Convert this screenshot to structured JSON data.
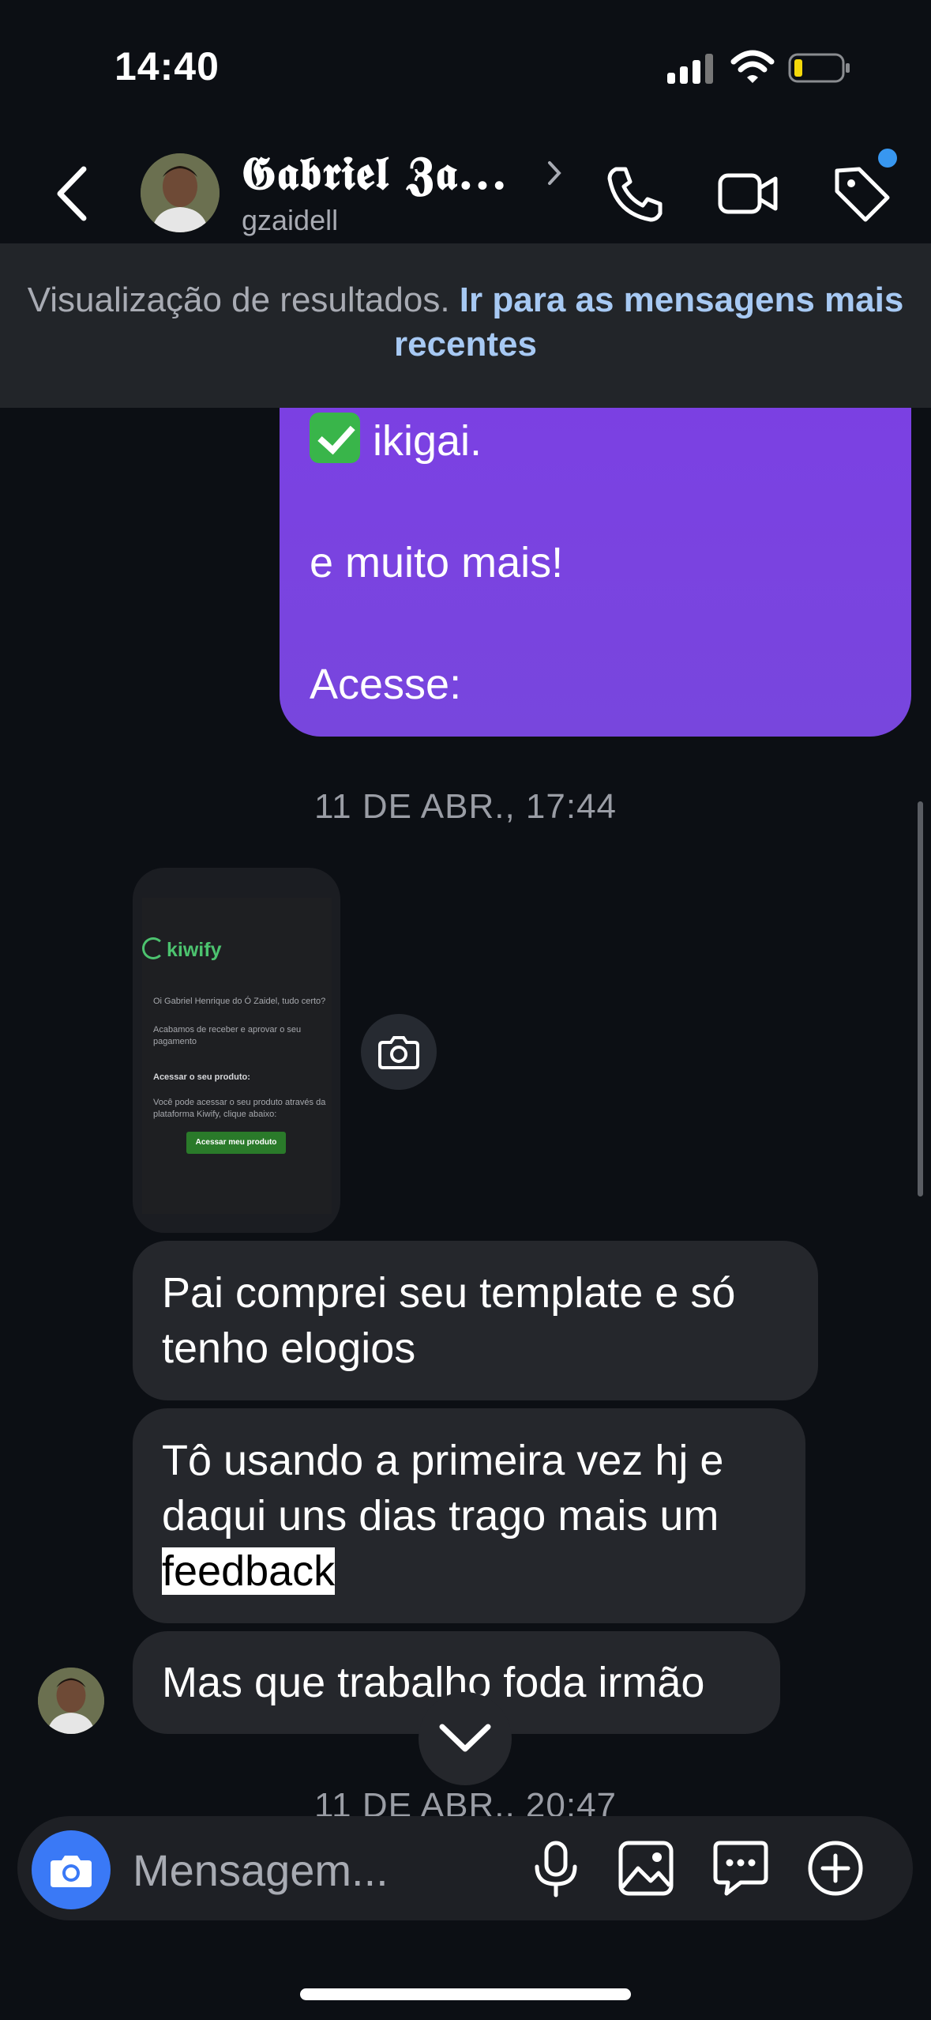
{
  "status_bar": {
    "time": "14:40"
  },
  "header": {
    "contact_name": "𝕲𝖆𝖇𝖗𝖎𝖊𝖑 𝖅𝖆...",
    "username": "gzaidell"
  },
  "banner": {
    "text": "Visualização de resultados.",
    "link": "Ir para as mensagens mais recentes"
  },
  "sent_message": {
    "line1": "ikigai.",
    "line2": "e muito mais!",
    "line3": "Acesse:"
  },
  "timestamps": [
    "11 DE ABR., 17:44",
    "11 DE ABR., 20:47"
  ],
  "email_preview": {
    "brand": "kiwify",
    "greeting": "Oi Gabriel Henrique do Ó Zaidel, tudo certo?",
    "body1": "Acabamos de receber e aprovar o seu pagamento",
    "section_title": "Acessar o seu produto:",
    "body2": "Você pode acessar o seu produto através da plataforma Kiwify, clique abaixo:",
    "button": "Acessar meu produto"
  },
  "received_messages": [
    {
      "lines": [
        "Pai comprei seu template e só",
        "tenho elogios"
      ]
    },
    {
      "lines": [
        "Tô usando a primeira vez hj e",
        "daqui uns dias trago mais um"
      ],
      "highlight": "feedback"
    },
    {
      "lines": [
        "Mas que trabalho foda irmão"
      ]
    }
  ],
  "composer": {
    "placeholder": "Mensagem..."
  },
  "colors": {
    "background": "#0c0f14",
    "sent_bubble": "#7c3fe4",
    "received_bubble": "#25272c",
    "link": "#a7c9f3",
    "camera_button": "#3a79f6",
    "notification_dot": "#3897f0"
  }
}
